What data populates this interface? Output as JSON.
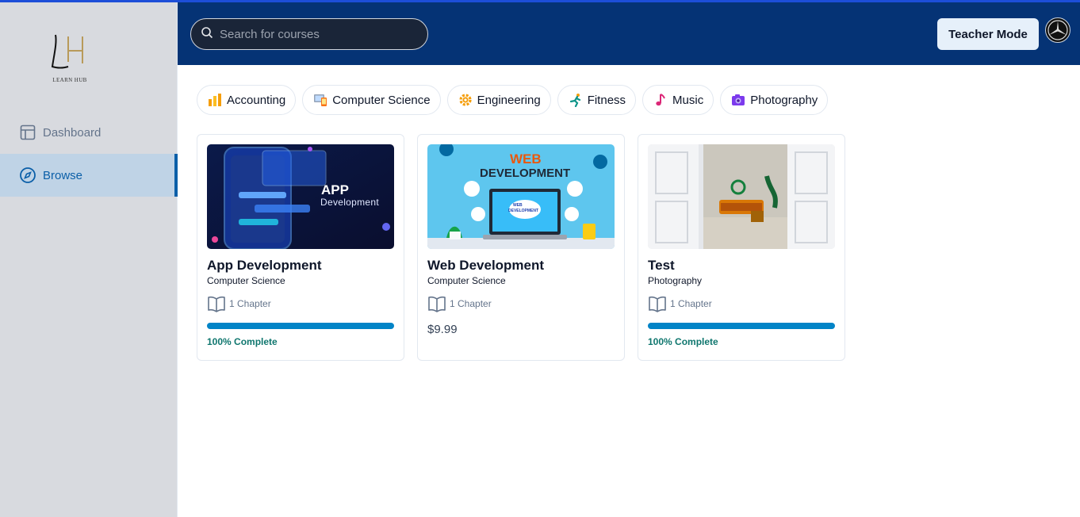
{
  "app": {
    "logo_text": "LEARN HUB"
  },
  "sidebar": {
    "items": [
      {
        "label": "Dashboard",
        "icon": "layout-icon",
        "active": false
      },
      {
        "label": "Browse",
        "icon": "compass-icon",
        "active": true
      }
    ]
  },
  "header": {
    "search_placeholder": "Search for courses",
    "teacher_mode_label": "Teacher Mode"
  },
  "categories": [
    {
      "label": "Accounting",
      "icon": "bar-chart-emoji-icon"
    },
    {
      "label": "Computer Science",
      "icon": "computer-emoji-icon"
    },
    {
      "label": "Engineering",
      "icon": "gear-emoji-icon"
    },
    {
      "label": "Fitness",
      "icon": "runner-emoji-icon"
    },
    {
      "label": "Music",
      "icon": "music-note-emoji-icon"
    },
    {
      "label": "Photography",
      "icon": "camera-emoji-icon"
    }
  ],
  "courses": [
    {
      "title": "App Development",
      "category": "Computer Science",
      "chapters": "1 Chapter",
      "progress": 1.0,
      "progress_label": "100% Complete",
      "thumb_text_1": "APP",
      "thumb_text_2": "Development"
    },
    {
      "title": "Web Development",
      "category": "Computer Science",
      "chapters": "1 Chapter",
      "price": "$9.99",
      "thumb_text_1": "WEB",
      "thumb_text_2": "DEVELOPMENT",
      "thumb_text_3": "WEB",
      "thumb_text_4": "DEVELOPMENT"
    },
    {
      "title": "Test",
      "category": "Photography",
      "chapters": "1 Chapter",
      "progress": 1.0,
      "progress_label": "100% Complete"
    }
  ],
  "colors": {
    "header_bg": "#053375",
    "sidebar_bg": "#d8dadf",
    "accent": "#0284c7",
    "active_nav": "#0b5fa8",
    "complete_text": "#0f766e"
  }
}
